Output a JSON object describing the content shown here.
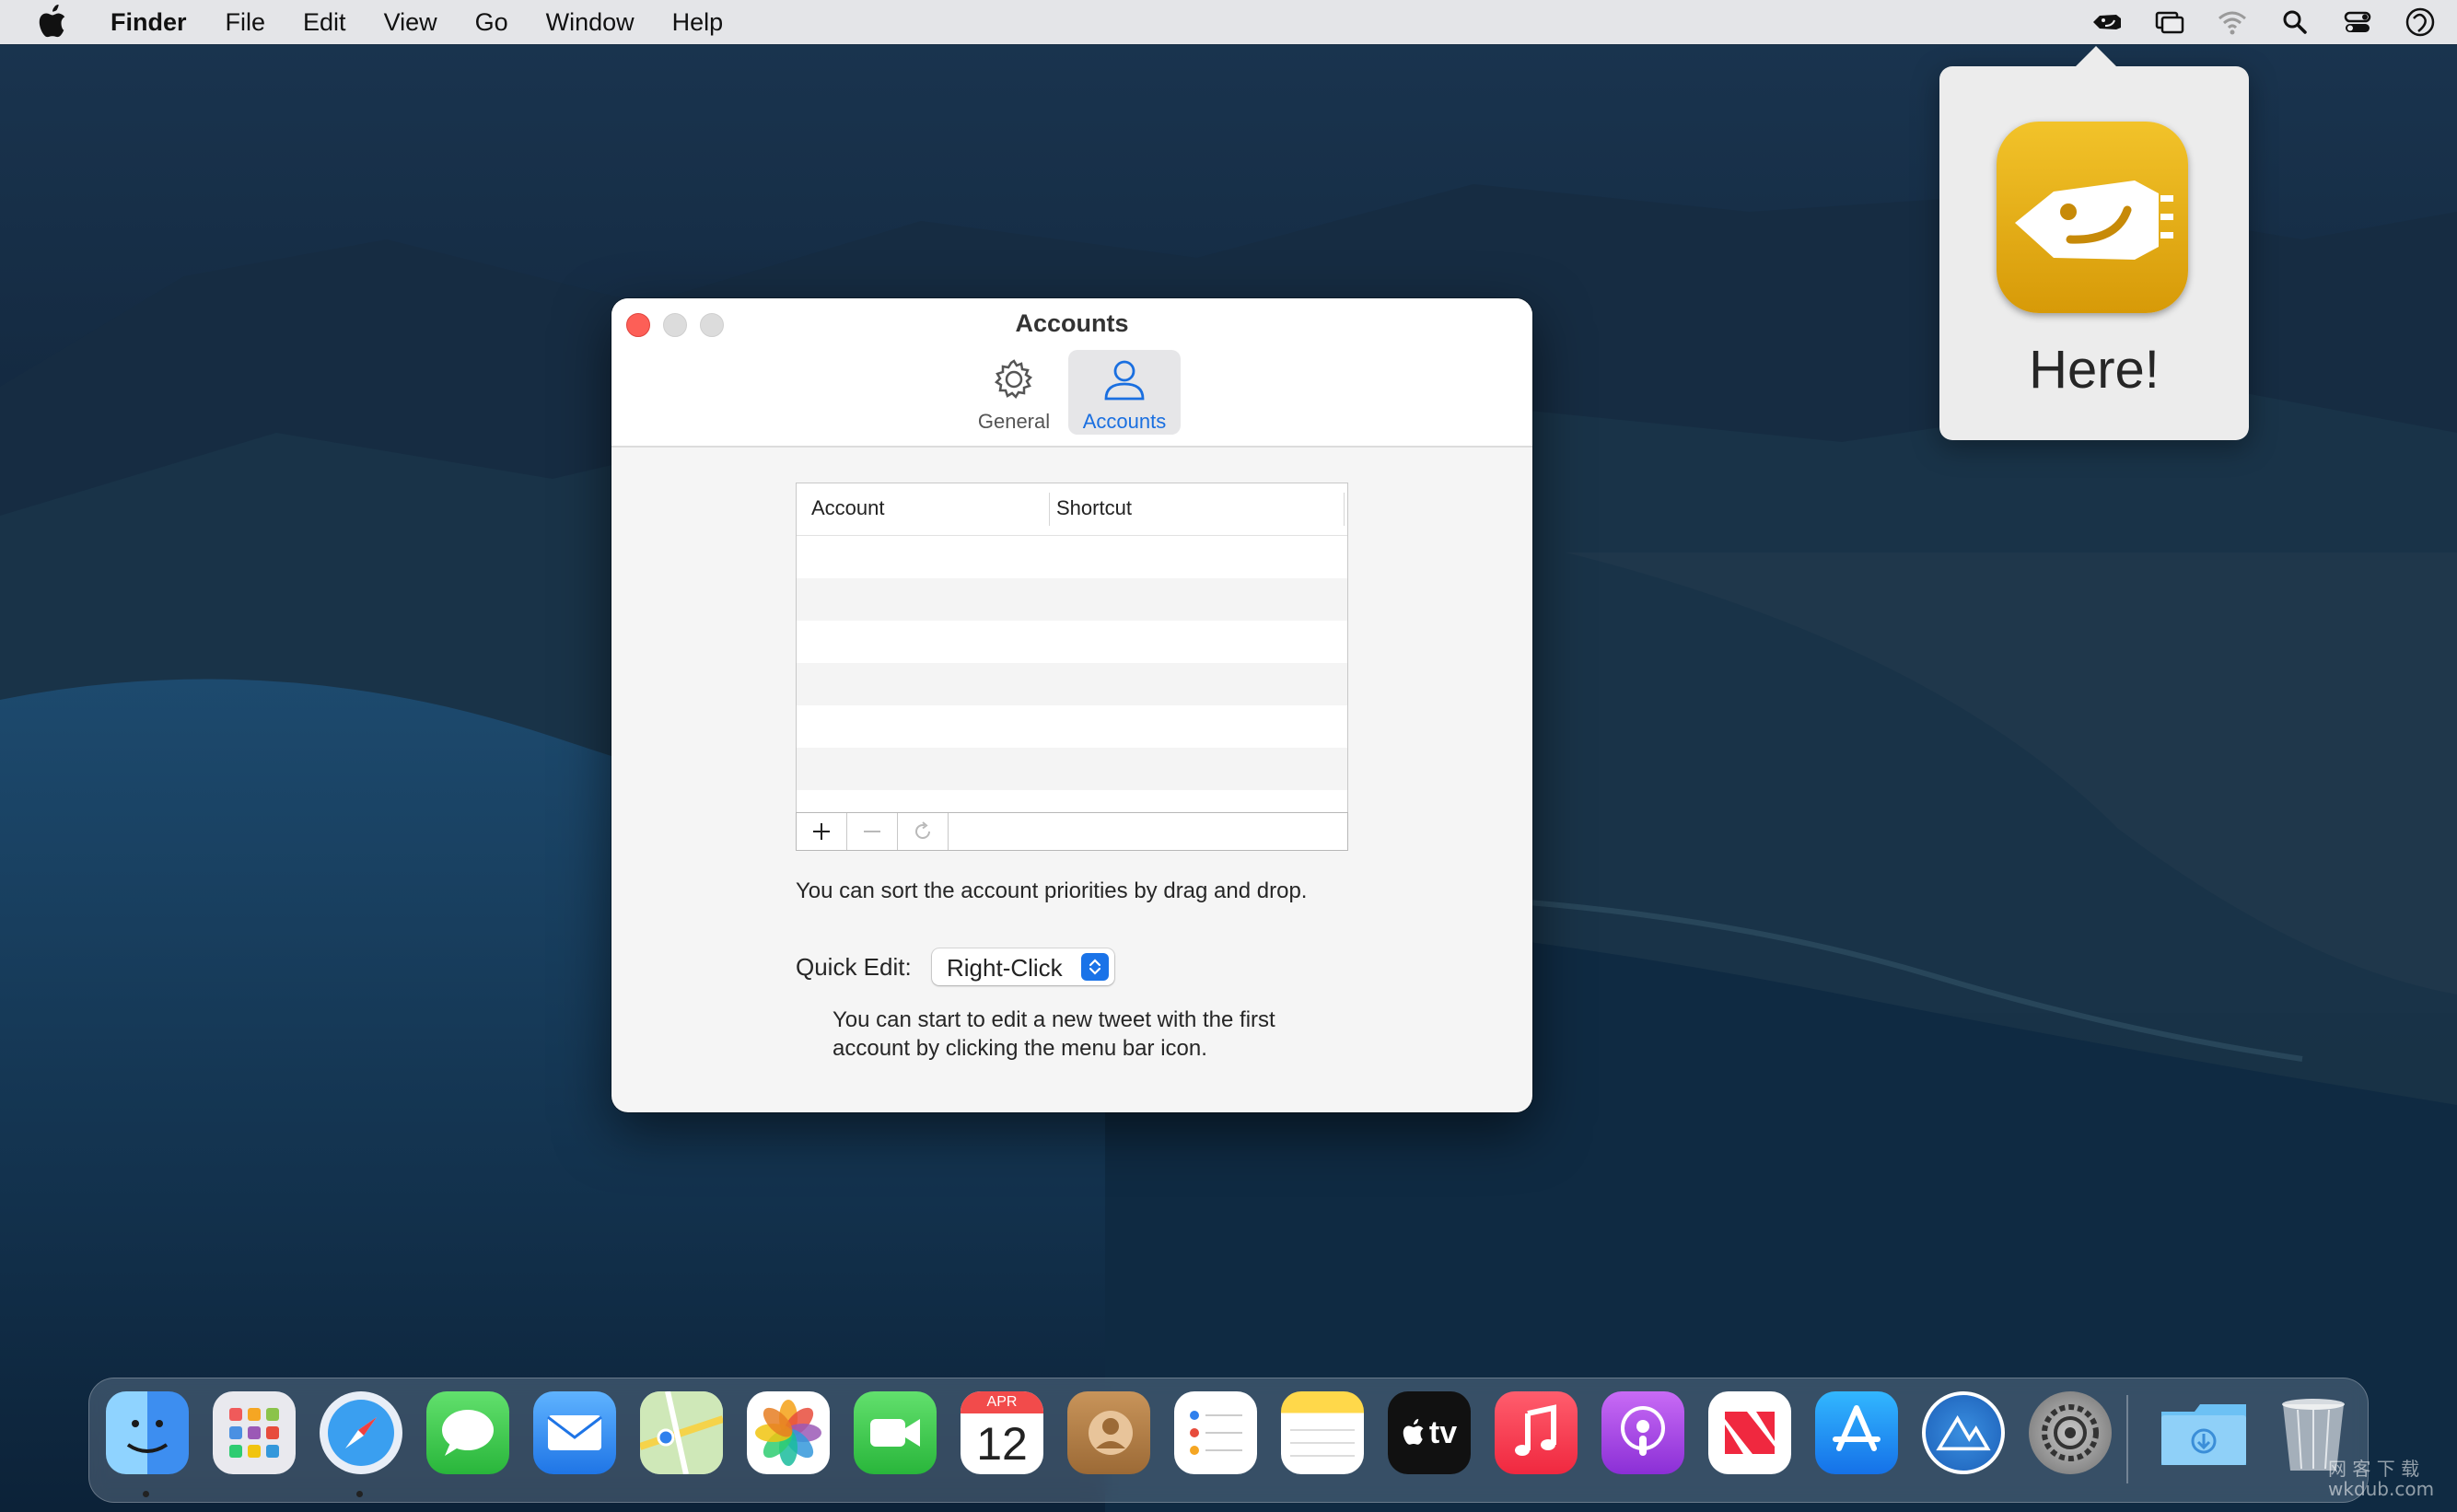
{
  "menubar": {
    "app_name": "Finder",
    "items": [
      "File",
      "Edit",
      "View",
      "Go",
      "Window",
      "Help"
    ],
    "status_icons": [
      "tweet-app-icon",
      "screens-icon",
      "wifi-icon",
      "search-icon",
      "control-center-icon",
      "siri-icon"
    ]
  },
  "popover": {
    "text": "Here!"
  },
  "window": {
    "title": "Accounts",
    "tabs": [
      {
        "label": "General",
        "icon": "gear-icon"
      },
      {
        "label": "Accounts",
        "icon": "person-icon",
        "selected": true
      }
    ],
    "table": {
      "columns": [
        "Account",
        "Shortcut"
      ],
      "rows": []
    },
    "table_buttons": [
      "add-icon",
      "remove-icon",
      "refresh-icon"
    ],
    "sort_hint": "You can sort the account priorities by drag and drop.",
    "quick_edit": {
      "label": "Quick Edit:",
      "value": "Right-Click"
    },
    "quick_edit_hint": "You can start to edit a new tweet with the first account by clicking the menu bar icon."
  },
  "dock": {
    "apps": [
      "Finder",
      "Launchpad",
      "Safari",
      "Messages",
      "Mail",
      "Maps",
      "Photos",
      "FaceTime",
      "Calendar",
      "Contacts",
      "Reminders",
      "Notes",
      "TV",
      "Music",
      "Podcasts",
      "News",
      "App Store",
      "Tweet App",
      "System Preferences",
      "Downloads",
      "Trash"
    ],
    "calendar": {
      "month": "APR",
      "day": "12"
    },
    "tv_label": "tv"
  },
  "watermark": "网 客 下 载\nwkdub.com"
}
